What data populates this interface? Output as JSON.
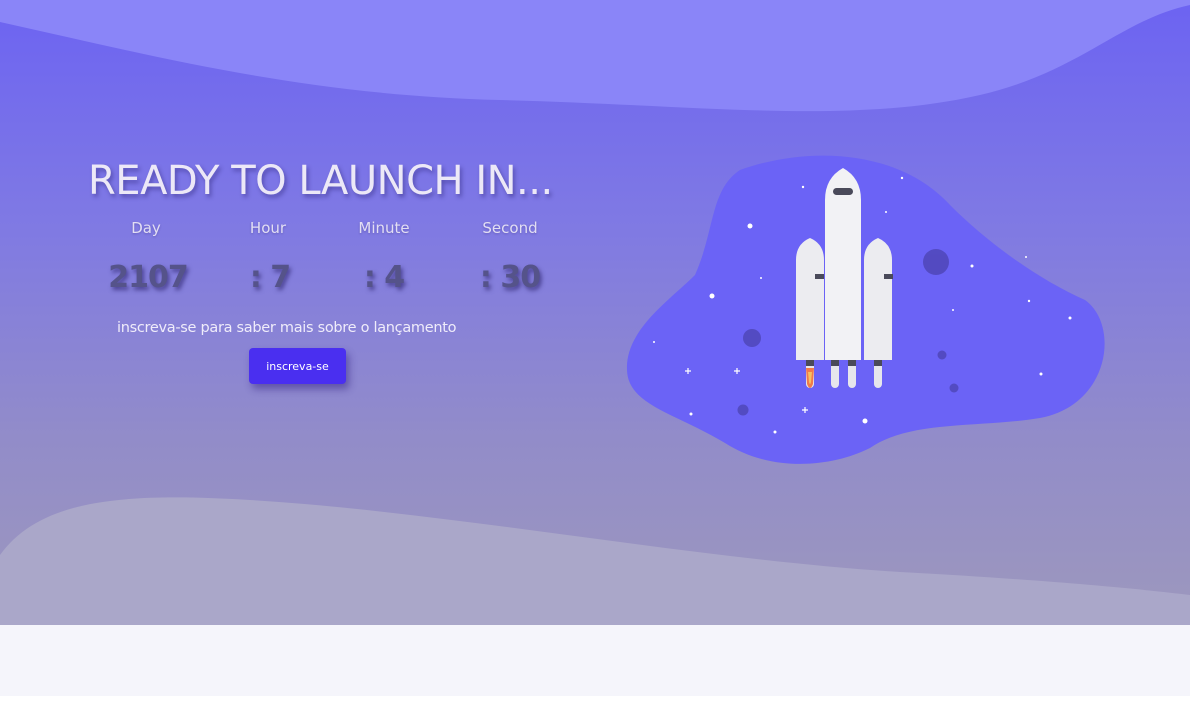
{
  "hero": {
    "title": "READY TO LAUNCH IN...",
    "countdown": [
      {
        "label": "Day",
        "value": "2107"
      },
      {
        "label": "Hour",
        "value": ": 7"
      },
      {
        "label": "Minute",
        "value": ": 4"
      },
      {
        "label": "Second",
        "value": ": 30"
      }
    ],
    "subtitle": "inscreva-se para saber mais sobre o lançamento",
    "cta_label": "inscreva-se"
  },
  "illustration": {
    "icon": "rocket-icon",
    "blob_color": "#6b63f6",
    "rocket_color": "#ececf0"
  },
  "colors": {
    "accent": "#4a2ff0",
    "background_top": "#6c63f2",
    "background_bottom": "#9d98bd",
    "footer": "#f5f5fb"
  }
}
